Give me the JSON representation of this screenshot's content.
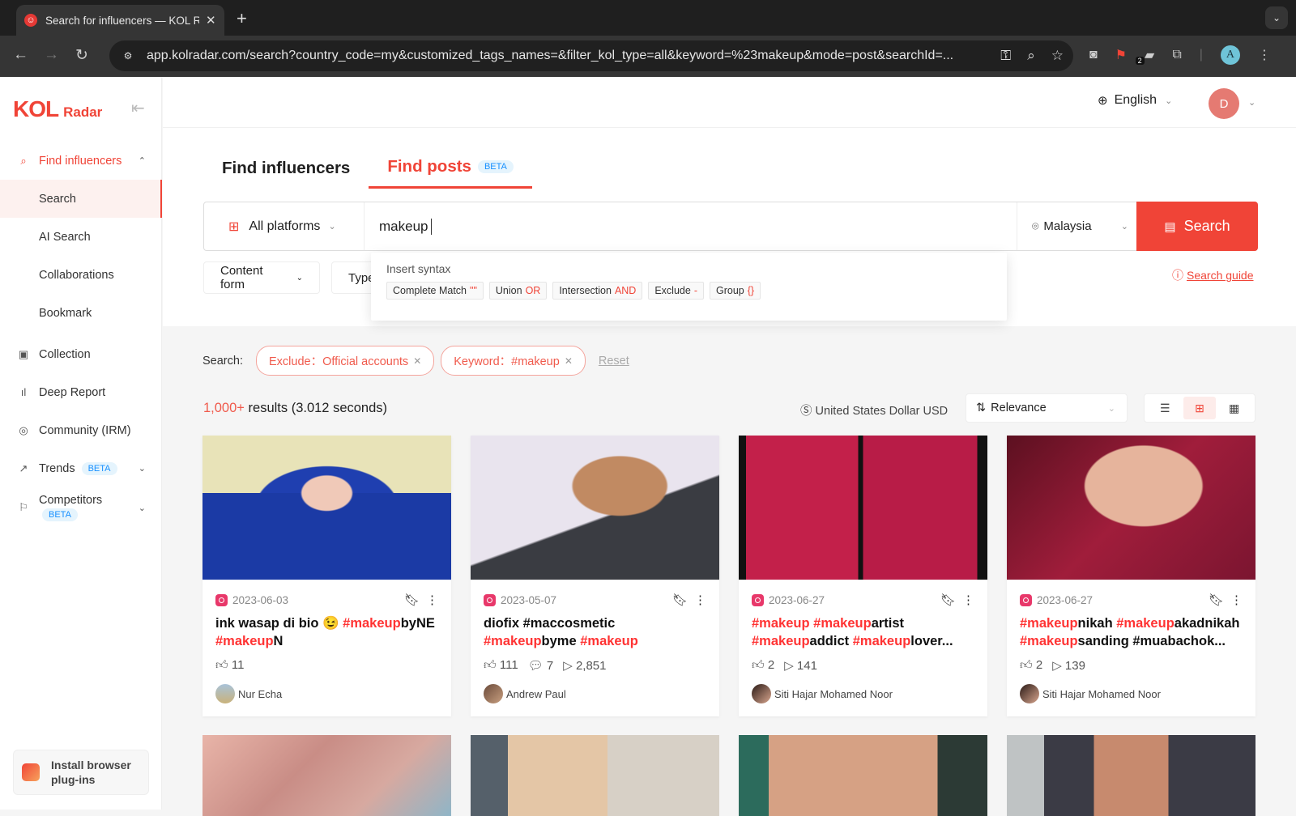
{
  "browser": {
    "tab_title": "Search for influencers — KOL Radar",
    "url": "app.kolradar.com/search?country_code=my&customized_tags_names=&filter_kol_type=all&keyword=%23makeup&mode=post&searchId=...",
    "extension_badge": "2",
    "profile_initial": "A"
  },
  "sidebar": {
    "logo_main": "KOL",
    "logo_sub": "Radar",
    "items": [
      {
        "label": "Find influencers",
        "icon": "search-icon"
      },
      {
        "label": "Search"
      },
      {
        "label": "AI Search"
      },
      {
        "label": "Collaborations"
      },
      {
        "label": "Bookmark"
      },
      {
        "label": "Collection",
        "icon": "collection-icon"
      },
      {
        "label": "Deep Report",
        "icon": "bar-chart-icon"
      },
      {
        "label": "Community (IRM)",
        "icon": "community-icon"
      },
      {
        "label": "Trends",
        "badge": "BETA",
        "icon": "trend-icon"
      },
      {
        "label": "Competitors",
        "badge": "BETA",
        "icon": "flag-icon"
      }
    ],
    "plugin_label": "Install browser plug-ins"
  },
  "header": {
    "language": "English",
    "avatar_initial": "D"
  },
  "search": {
    "tabs": [
      {
        "label": "Find influencers",
        "active": false
      },
      {
        "label": "Find posts",
        "badge": "BETA",
        "active": true
      }
    ],
    "platform": "All platforms",
    "query": "makeup",
    "country": "Malaysia",
    "button_label": "Search",
    "filters": [
      "Content form",
      "Type"
    ],
    "guide_label": "Search guide",
    "syntax": {
      "title": "Insert syntax",
      "chips": [
        {
          "label": "Complete Match",
          "op": "\"\""
        },
        {
          "label": "Union",
          "op": "OR"
        },
        {
          "label": "Intersection",
          "op": "AND"
        },
        {
          "label": "Exclude",
          "op": "-"
        },
        {
          "label": "Group",
          "op": "{}"
        }
      ]
    }
  },
  "criteria": {
    "label": "Search:",
    "tags": [
      "Exclude：Official accounts",
      "Keyword：#makeup"
    ],
    "reset_label": "Reset"
  },
  "results": {
    "count": "1,000+",
    "count_suffix": " results (3.012 seconds)",
    "currency": "United States Dollar USD",
    "sort": "Relevance",
    "view_modes": [
      "list",
      "grid",
      "table"
    ],
    "active_view": "grid"
  },
  "posts": [
    {
      "date": "2023-06-03",
      "platform": "instagram",
      "caption": [
        [
          "ink wasap di bio 😉 ",
          false
        ],
        [
          "#makeup",
          true
        ],
        [
          "byNE ",
          false
        ],
        [
          "#makeup",
          true
        ],
        [
          "N",
          false
        ]
      ],
      "likes": "11",
      "comments": null,
      "views": null,
      "author": "Nur Echa"
    },
    {
      "date": "2023-05-07",
      "platform": "instagram",
      "caption": [
        [
          "diofix #maccosmetic ",
          false
        ],
        [
          "#makeup",
          true
        ],
        [
          "byme ",
          false
        ],
        [
          "#makeup",
          true
        ]
      ],
      "likes": "111",
      "comments": "7",
      "views": "2,851",
      "author": "Andrew Paul"
    },
    {
      "date": "2023-06-27",
      "platform": "instagram",
      "caption": [
        [
          "#makeup",
          true
        ],
        [
          " ",
          false
        ],
        [
          "#makeup",
          true
        ],
        [
          "artist ",
          false
        ],
        [
          "#makeup",
          true
        ],
        [
          "addict ",
          false
        ],
        [
          "#makeup",
          true
        ],
        [
          "lover...",
          false
        ]
      ],
      "likes": "2",
      "comments": null,
      "views": "141",
      "author": "Siti Hajar Mohamed Noor"
    },
    {
      "date": "2023-06-27",
      "platform": "instagram",
      "caption": [
        [
          "#makeup",
          true
        ],
        [
          "nikah ",
          false
        ],
        [
          "#makeup",
          true
        ],
        [
          "akadnikah ",
          false
        ],
        [
          "#makeup",
          true
        ],
        [
          "sanding #muabachok...",
          false
        ]
      ],
      "likes": "2",
      "comments": null,
      "views": "139",
      "author": "Siti Hajar Mohamed Noor"
    }
  ],
  "colors": {
    "brand": "#f04437",
    "beta_bg": "#e5f4fd",
    "beta_text": "#1890ff"
  }
}
